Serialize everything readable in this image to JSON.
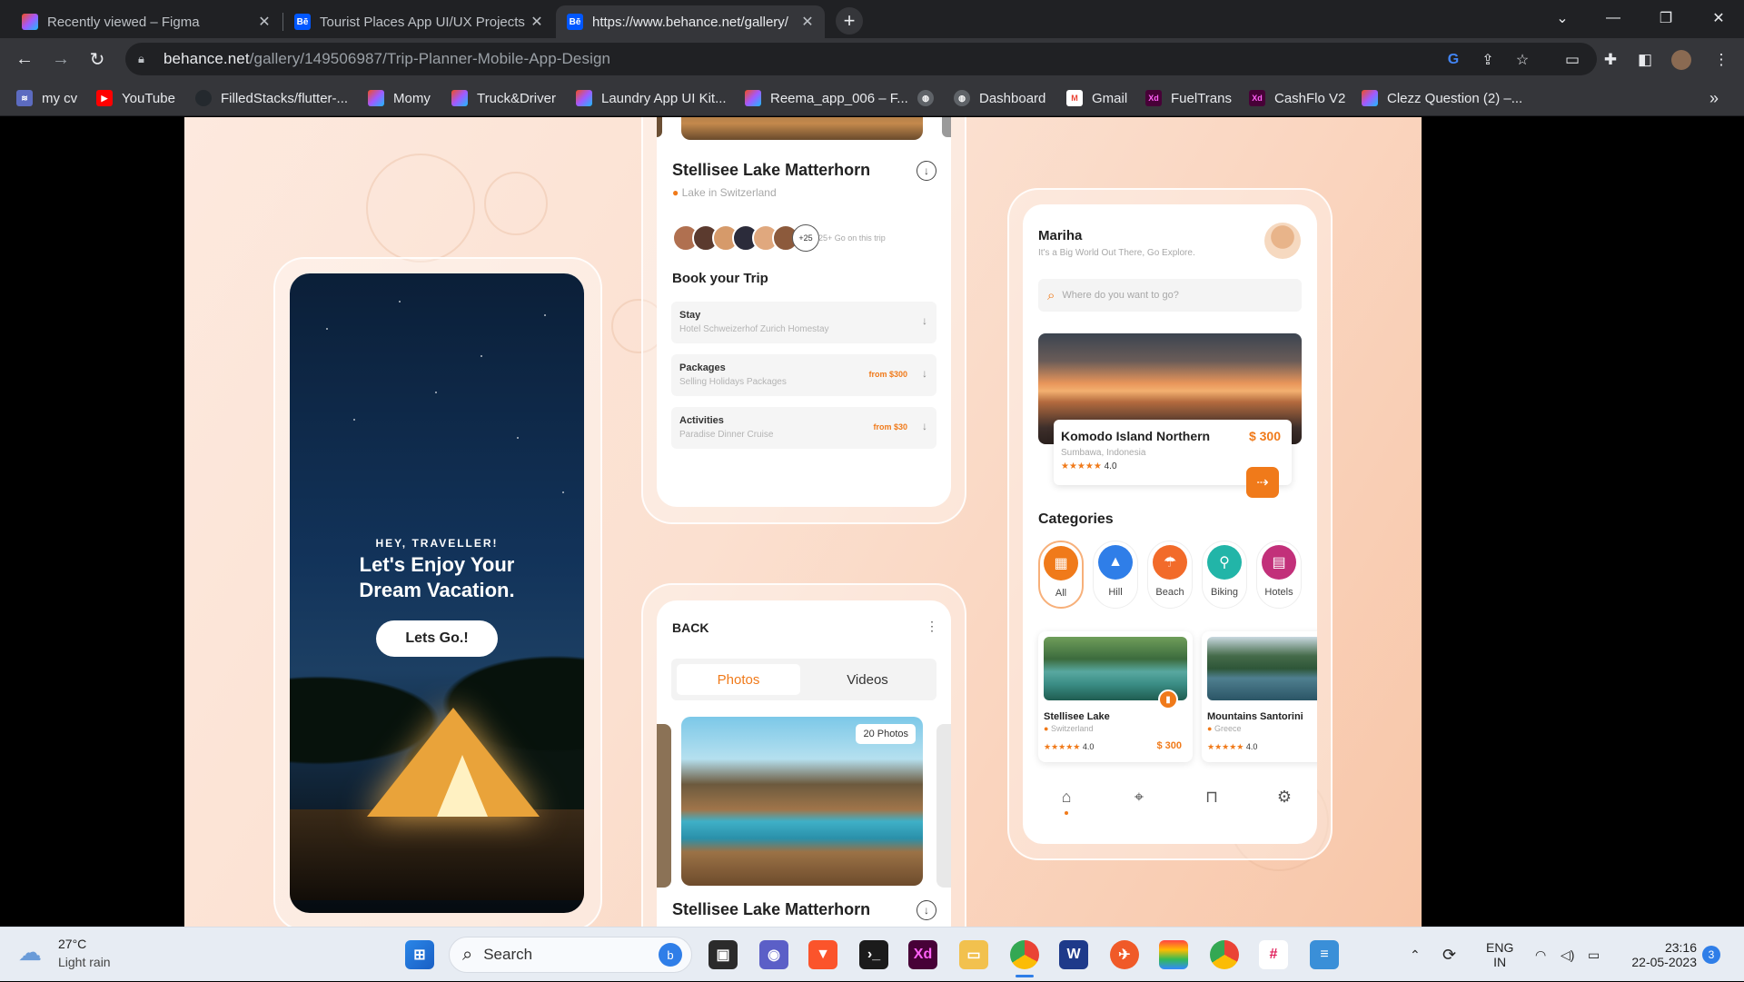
{
  "browser": {
    "tabs": [
      {
        "title": "Recently viewed – Figma",
        "active": false,
        "icon": "figma-icon"
      },
      {
        "title": "Tourist Places App UI/UX Projects",
        "active": false,
        "icon": "behance-icon",
        "favicon_text": "Bē"
      },
      {
        "title": "https://www.behance.net/gallery/",
        "active": true,
        "icon": "behance-icon",
        "favicon_text": "Bē"
      }
    ],
    "url_host": "behance.net",
    "url_path": "/gallery/149506987/Trip-Planner-Mobile-App-Design",
    "bookmarks": [
      {
        "label": "my cv",
        "icon": "layers-icon"
      },
      {
        "label": "YouTube",
        "icon": "youtube-icon"
      },
      {
        "label": "FilledStacks/flutter-...",
        "icon": "github-icon"
      },
      {
        "label": "Momy",
        "icon": "figma-icon"
      },
      {
        "label": "Truck&Driver",
        "icon": "figma-icon"
      },
      {
        "label": "Laundry App UI Kit...",
        "icon": "figma-icon"
      },
      {
        "label": "Reema_app_006 – F...",
        "icon": "figma-icon"
      },
      {
        "label": "",
        "icon": "globe-icon"
      },
      {
        "label": "Dashboard",
        "icon": "globe-icon"
      },
      {
        "label": "Gmail",
        "icon": "gmail-icon"
      },
      {
        "label": "FuelTrans",
        "icon": "xd-icon",
        "icon_text": "Xd"
      },
      {
        "label": "CashFlo V2",
        "icon": "xd-icon",
        "icon_text": "Xd"
      },
      {
        "label": "Clezz Question (2) –...",
        "icon": "figma-icon"
      }
    ],
    "more_bookmarks": "»"
  },
  "splash": {
    "eyebrow": "HEY, TRAVELLER!",
    "headline_line1": "Let's Enjoy Your",
    "headline_line2": "Dream Vacation.",
    "cta": "Lets Go.!"
  },
  "details": {
    "title": "Stellisee Lake Matterhorn",
    "location": "Lake in Switzerland",
    "extra_count": "+25",
    "going_text": "25+ Go on this trip",
    "book_heading": "Book your Trip",
    "options": [
      {
        "title": "Stay",
        "subtitle": "Hotel Schweizerhof Zurich Homestay",
        "price": ""
      },
      {
        "title": "Packages",
        "subtitle": "Selling Holidays Packages",
        "price": "from $300"
      },
      {
        "title": "Activities",
        "subtitle": "Paradise Dinner Cruise",
        "price": "from $30"
      }
    ]
  },
  "gallery": {
    "back": "BACK",
    "tabs": [
      "Photos",
      "Videos"
    ],
    "photo_count": "20 Photos",
    "title": "Stellisee Lake Matterhorn"
  },
  "home": {
    "user": "Mariha",
    "tagline": "It's a Big World Out There, Go Explore.",
    "search_placeholder": "Where do you want to go?",
    "featured": {
      "name": "Komodo Island Northern",
      "price": "$ 300",
      "location": "Sumbawa, Indonesia",
      "stars": "★★★★★",
      "rating": "4.0"
    },
    "categories_heading": "Categories",
    "categories": [
      {
        "label": "All",
        "color": "#f07a1a",
        "icon": "grid-icon",
        "glyph": "▦"
      },
      {
        "label": "Hill",
        "color": "#2f7ee8",
        "icon": "mountain-icon",
        "glyph": "▲"
      },
      {
        "label": "Beach",
        "color": "#f26b2a",
        "icon": "umbrella-icon",
        "glyph": "☂"
      },
      {
        "label": "Biking",
        "color": "#22b5a8",
        "icon": "bike-icon",
        "glyph": "⚲"
      },
      {
        "label": "Hotels",
        "color": "#c2307a",
        "icon": "hotel-icon",
        "glyph": "▤"
      }
    ],
    "places": [
      {
        "name": "Stellisee Lake",
        "location": "Switzerland",
        "stars": "★★★★★",
        "rating": "4.0",
        "price": "$ 300"
      },
      {
        "name": "Mountains Santorini",
        "location": "Greece",
        "stars": "★★★★★",
        "rating": "4.0",
        "price": "$"
      }
    ]
  },
  "taskbar": {
    "temp": "27°C",
    "weather": "Light rain",
    "search": "Search",
    "lang1": "ENG",
    "lang2": "IN",
    "time": "23:16",
    "date": "22-05-2023",
    "notifications": "3"
  },
  "colors": {
    "accent": "#f07a1a",
    "chrome_dark": "#202124",
    "chrome_mid": "#35363a"
  }
}
